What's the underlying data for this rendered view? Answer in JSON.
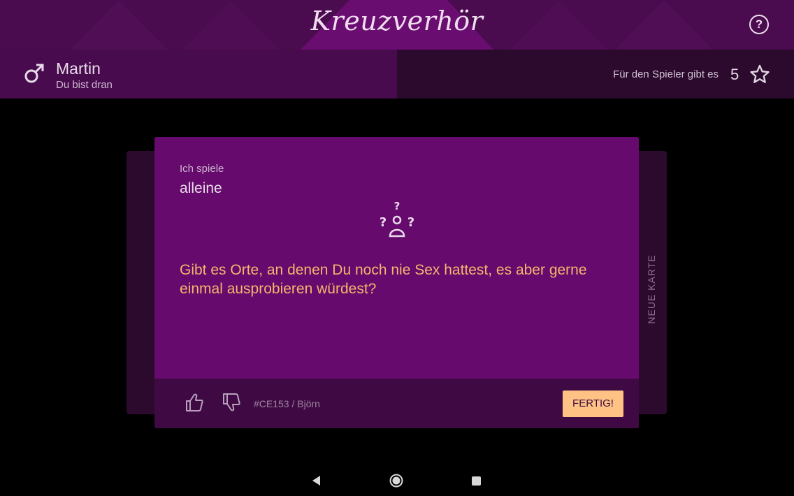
{
  "header": {
    "title": "Kreuzverhör",
    "help_symbol": "?",
    "help_icon": "help-circle-icon",
    "color": "#4a0b4f"
  },
  "player": {
    "name": "Martin",
    "status": "Du bist dran",
    "gender_icon": "male-icon",
    "points_label": "Für den Spieler gibt es",
    "points_value": "5",
    "points_icon": "star-icon"
  },
  "card": {
    "mode_label": "Ich spiele",
    "mode_value": "alleine",
    "mode_icon": "person-question-icon",
    "question": "Gibt es Orte, an denen Du noch nie Sex hattest, es aber gerne einmal ausprobieren würdest?",
    "reference": "#CE153 / Björn",
    "done_label": "FERTIG!",
    "side_label": "NEUE KARTE",
    "color": "#660a6d",
    "question_color": "#f6b56d",
    "button_color": "#ffc285"
  },
  "navigation": {
    "back_icon": "back-triangle-icon",
    "home_icon": "home-circle-icon",
    "recent_icon": "recent-square-icon"
  }
}
